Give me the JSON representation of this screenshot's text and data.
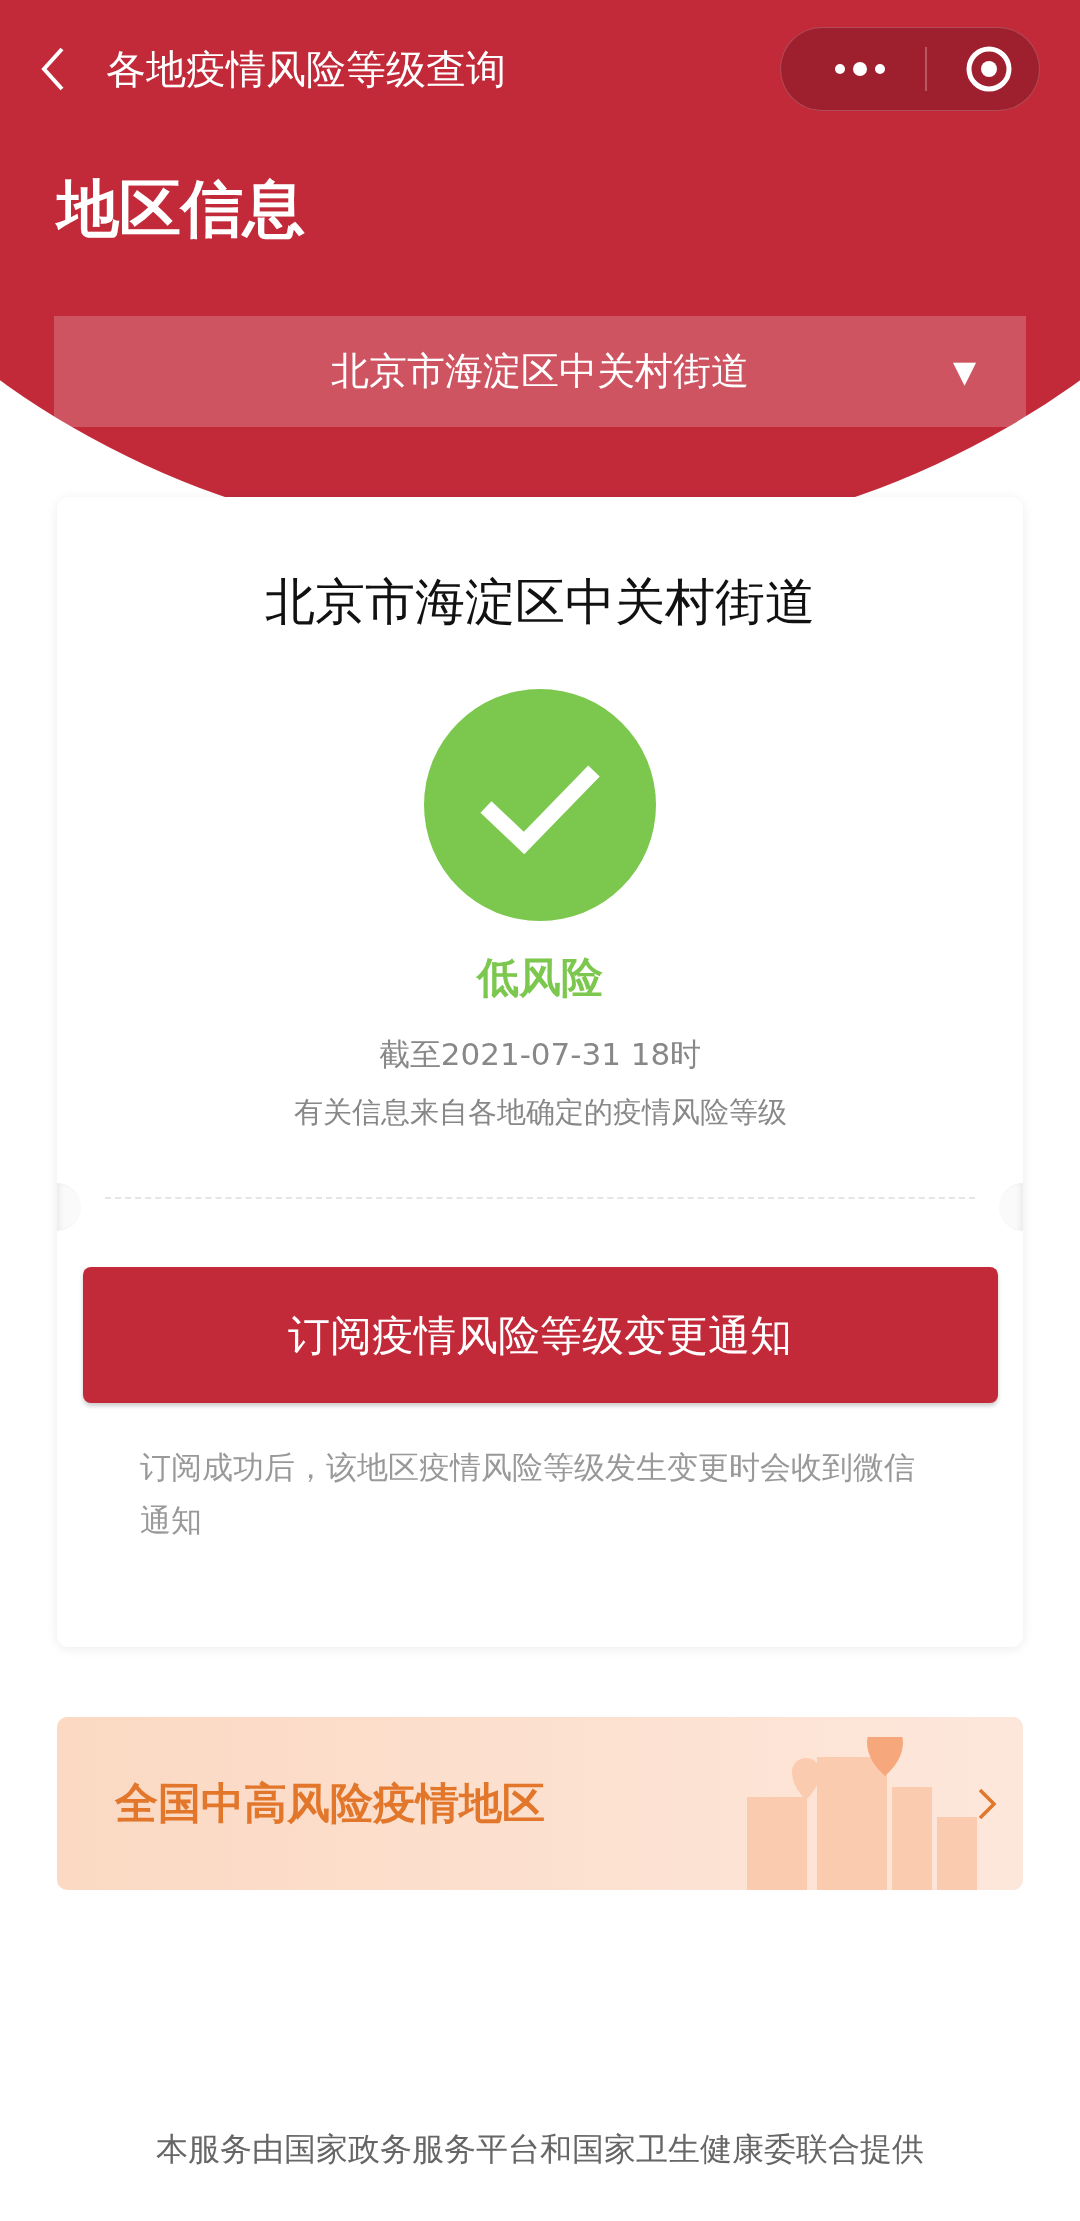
{
  "nav_bar": {
    "title": "各地疫情风险等级查询"
  },
  "header": {
    "title": "地区信息",
    "region_select": {
      "value": "北京市海淀区中关村街道",
      "arrow": "▼"
    }
  },
  "result_card": {
    "region": "北京市海淀区中关村街道",
    "risk": {
      "kind": "low",
      "label": "低风险"
    },
    "as_of": "截至2021-07-31 18时",
    "source_note": "有关信息来自各地确定的疫情风险等级",
    "subscribe_button": "订阅疫情风险等级变更通知",
    "subscribe_note": "订阅成功后，该地区疫情风险等级发生变更时会收到微信通知"
  },
  "banner": {
    "label": "全国中高风险疫情地区"
  },
  "footer": "本服务由国家政务服务平台和国家卫生健康委联合提供"
}
